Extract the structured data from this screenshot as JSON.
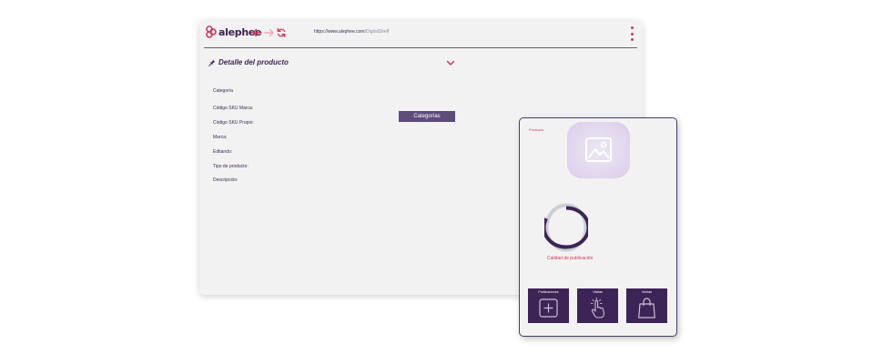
{
  "browser": {
    "logo_text": "alephee",
    "url_host": "https://www.alephee.com",
    "url_path": "/DigitalShelf"
  },
  "detail": {
    "title": "Detalle del producto",
    "fields": [
      "Categoría",
      "Código SKU Marca:",
      "Código SKU Propio:",
      "Marca:",
      "Editando:",
      "Tipo de producto:",
      "Descripción:"
    ],
    "category_button": "Categorías"
  },
  "product_card": {
    "label": "Producto",
    "quality_label": "Calidad de publicación",
    "quality_progress": 0.82,
    "tiles": [
      {
        "label": "Publicaciones",
        "icon": "plus-square-icon"
      },
      {
        "label": "Visitas",
        "icon": "pointer-hand-icon"
      },
      {
        "label": "Ventas",
        "icon": "shopping-bag-icon"
      }
    ]
  },
  "colors": {
    "brand_pink": "#d6345b",
    "brand_purple": "#3d2456",
    "button_purple": "#5e4c7b",
    "window_bg": "#f2f2f2"
  }
}
